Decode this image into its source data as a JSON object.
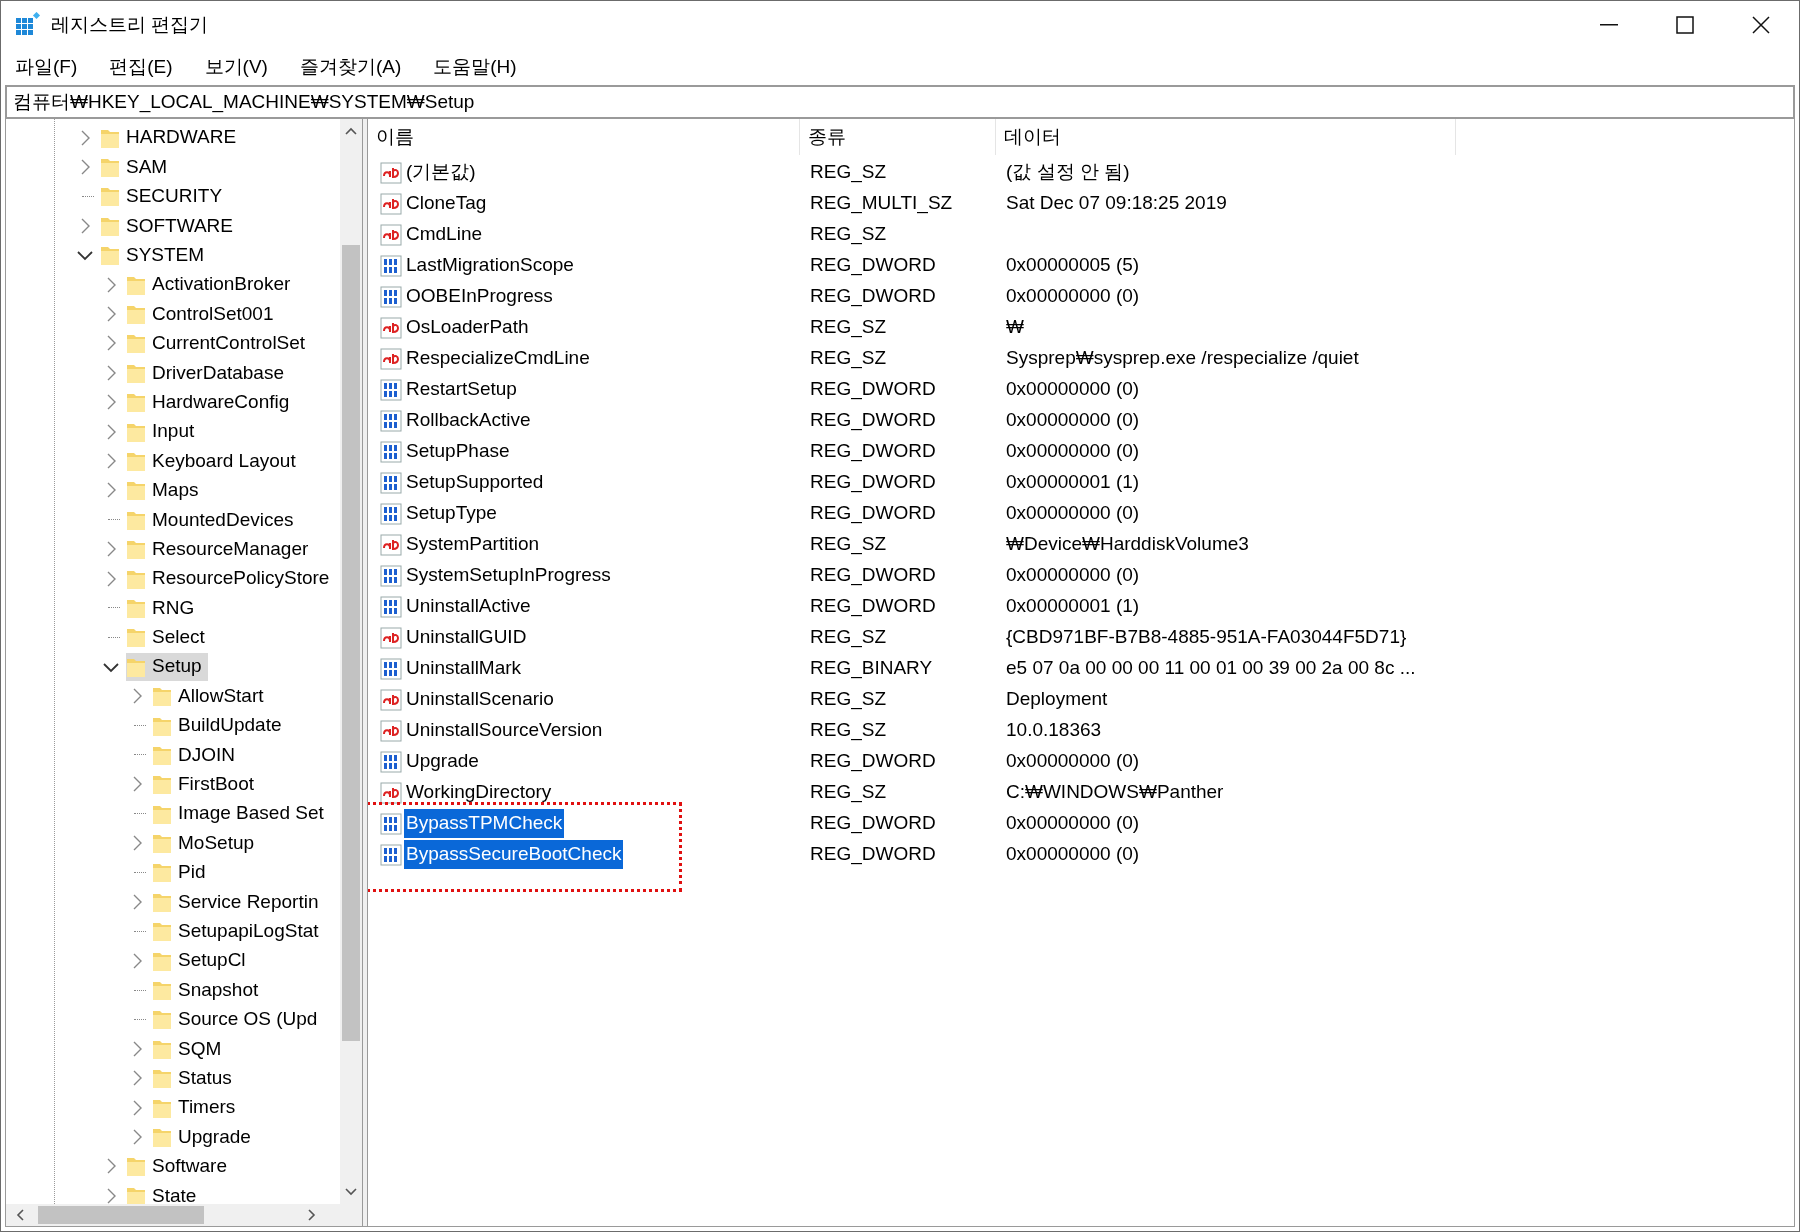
{
  "window": {
    "title": "레지스트리 편집기"
  },
  "menu": [
    "파일(F)",
    "편집(E)",
    "보기(V)",
    "즐겨찾기(A)",
    "도움말(H)"
  ],
  "address": "컴퓨터₩HKEY_LOCAL_MACHINE₩SYSTEM₩Setup",
  "tree": [
    {
      "label": "HARDWARE",
      "kind": "branch",
      "expanded": false,
      "selected": false
    },
    {
      "label": "SAM",
      "kind": "branch",
      "expanded": false,
      "selected": false
    },
    {
      "label": "SECURITY",
      "kind": "leaf",
      "selected": false
    },
    {
      "label": "SOFTWARE",
      "kind": "branch",
      "expanded": false,
      "selected": false
    },
    {
      "label": "SYSTEM",
      "kind": "branch",
      "expanded": true,
      "selected": false,
      "children": [
        {
          "label": "ActivationBroker",
          "kind": "branch",
          "expanded": false,
          "selected": false
        },
        {
          "label": "ControlSet001",
          "kind": "branch",
          "expanded": false,
          "selected": false
        },
        {
          "label": "CurrentControlSet",
          "kind": "branch",
          "expanded": false,
          "selected": false
        },
        {
          "label": "DriverDatabase",
          "kind": "branch",
          "expanded": false,
          "selected": false
        },
        {
          "label": "HardwareConfig",
          "kind": "branch",
          "expanded": false,
          "selected": false
        },
        {
          "label": "Input",
          "kind": "branch",
          "expanded": false,
          "selected": false
        },
        {
          "label": "Keyboard Layout",
          "kind": "branch",
          "expanded": false,
          "selected": false
        },
        {
          "label": "Maps",
          "kind": "branch",
          "expanded": false,
          "selected": false
        },
        {
          "label": "MountedDevices",
          "kind": "leaf",
          "selected": false
        },
        {
          "label": "ResourceManager",
          "kind": "branch",
          "expanded": false,
          "selected": false
        },
        {
          "label": "ResourcePolicyStore",
          "kind": "branch",
          "expanded": false,
          "selected": false
        },
        {
          "label": "RNG",
          "kind": "leaf",
          "selected": false
        },
        {
          "label": "Select",
          "kind": "leaf",
          "selected": false
        },
        {
          "label": "Setup",
          "kind": "branch",
          "expanded": true,
          "selected": true,
          "children": [
            {
              "label": "AllowStart",
              "kind": "branch",
              "expanded": false,
              "selected": false
            },
            {
              "label": "BuildUpdate",
              "kind": "leaf",
              "selected": false
            },
            {
              "label": "DJOIN",
              "kind": "leaf",
              "selected": false
            },
            {
              "label": "FirstBoot",
              "kind": "branch",
              "expanded": false,
              "selected": false
            },
            {
              "label": "Image Based Set",
              "kind": "leaf",
              "selected": false
            },
            {
              "label": "MoSetup",
              "kind": "branch",
              "expanded": false,
              "selected": false
            },
            {
              "label": "Pid",
              "kind": "leaf",
              "selected": false
            },
            {
              "label": "Service Reportin",
              "kind": "branch",
              "expanded": false,
              "selected": false
            },
            {
              "label": "SetupapiLogStat",
              "kind": "leaf",
              "selected": false
            },
            {
              "label": "SetupCl",
              "kind": "branch",
              "expanded": false,
              "selected": false
            },
            {
              "label": "Snapshot",
              "kind": "leaf",
              "selected": false
            },
            {
              "label": "Source OS (Upd",
              "kind": "leaf",
              "selected": false
            },
            {
              "label": "SQM",
              "kind": "branch",
              "expanded": false,
              "selected": false
            },
            {
              "label": "Status",
              "kind": "branch",
              "expanded": false,
              "selected": false
            },
            {
              "label": "Timers",
              "kind": "branch",
              "expanded": false,
              "selected": false
            },
            {
              "label": "Upgrade",
              "kind": "branch",
              "expanded": false,
              "selected": false
            }
          ]
        },
        {
          "label": "Software",
          "kind": "branch",
          "expanded": false,
          "selected": false
        },
        {
          "label": "State",
          "kind": "branch",
          "expanded": false,
          "selected": false
        }
      ]
    }
  ],
  "columns": [
    "이름",
    "종류",
    "데이터"
  ],
  "values": [
    {
      "name": "(기본값)",
      "type": "REG_SZ",
      "data": "(값 설정 안 됨)",
      "kind": "string",
      "selected": false
    },
    {
      "name": "CloneTag",
      "type": "REG_MULTI_SZ",
      "data": "Sat Dec 07 09:18:25 2019",
      "kind": "string",
      "selected": false
    },
    {
      "name": "CmdLine",
      "type": "REG_SZ",
      "kind": "string",
      "selected": false
    },
    {
      "name": "LastMigrationScope",
      "type": "REG_DWORD",
      "data": "0x00000005 (5)",
      "kind": "binary",
      "selected": false
    },
    {
      "name": "OOBEInProgress",
      "type": "REG_DWORD",
      "data": "0x00000000 (0)",
      "kind": "binary",
      "selected": false
    },
    {
      "name": "OsLoaderPath",
      "type": "REG_SZ",
      "data": "₩",
      "kind": "string",
      "selected": false
    },
    {
      "name": "RespecializeCmdLine",
      "type": "REG_SZ",
      "data": "Sysprep₩sysprep.exe /respecialize /quiet",
      "kind": "string",
      "selected": false
    },
    {
      "name": "RestartSetup",
      "type": "REG_DWORD",
      "data": "0x00000000 (0)",
      "kind": "binary",
      "selected": false
    },
    {
      "name": "RollbackActive",
      "type": "REG_DWORD",
      "data": "0x00000000 (0)",
      "kind": "binary",
      "selected": false
    },
    {
      "name": "SetupPhase",
      "type": "REG_DWORD",
      "data": "0x00000000 (0)",
      "kind": "binary",
      "selected": false
    },
    {
      "name": "SetupSupported",
      "type": "REG_DWORD",
      "data": "0x00000001 (1)",
      "kind": "binary",
      "selected": false
    },
    {
      "name": "SetupType",
      "type": "REG_DWORD",
      "data": "0x00000000 (0)",
      "kind": "binary",
      "selected": false
    },
    {
      "name": "SystemPartition",
      "type": "REG_SZ",
      "data": "₩Device₩HarddiskVolume3",
      "kind": "string",
      "selected": false
    },
    {
      "name": "SystemSetupInProgress",
      "type": "REG_DWORD",
      "data": "0x00000000 (0)",
      "kind": "binary",
      "selected": false
    },
    {
      "name": "UninstallActive",
      "type": "REG_DWORD",
      "data": "0x00000001 (1)",
      "kind": "binary",
      "selected": false
    },
    {
      "name": "UninstallGUID",
      "type": "REG_SZ",
      "data": "{CBD971BF-B7B8-4885-951A-FA03044F5D71}",
      "kind": "string",
      "selected": false
    },
    {
      "name": "UninstallMark",
      "type": "REG_BINARY",
      "data": "e5 07 0a 00 00 00 11 00 01 00 39 00 2a 00 8c ...",
      "kind": "binary",
      "selected": false
    },
    {
      "name": "UninstallScenario",
      "type": "REG_SZ",
      "data": "Deployment",
      "kind": "string",
      "selected": false
    },
    {
      "name": "UninstallSourceVersion",
      "type": "REG_SZ",
      "data": "10.0.18363",
      "kind": "string",
      "selected": false
    },
    {
      "name": "Upgrade",
      "type": "REG_DWORD",
      "data": "0x00000000 (0)",
      "kind": "binary",
      "selected": false
    },
    {
      "name": "WorkingDirectory",
      "type": "REG_SZ",
      "data": "C:₩WINDOWS₩Panther",
      "kind": "string",
      "selected": false
    },
    {
      "name": "BypassTPMCheck",
      "type": "REG_DWORD",
      "data": "0x00000000 (0)",
      "kind": "binary",
      "selected": true
    },
    {
      "name": "BypassSecureBootCheck",
      "type": "REG_DWORD",
      "data": "0x00000000 (0)",
      "kind": "binary",
      "selected": true
    }
  ]
}
